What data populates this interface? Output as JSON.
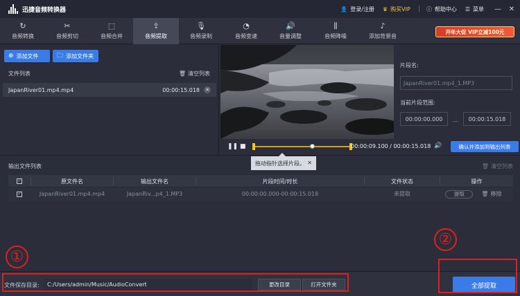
{
  "app": {
    "title": "迅捷音频转换器",
    "login": "登录/注册",
    "buy_vip": "购买VIP",
    "help": "帮助中心",
    "menu": "菜单",
    "minimize": "—",
    "close": "✕"
  },
  "tabs": [
    {
      "label": "音频转换",
      "icon": "↻"
    },
    {
      "label": "音频剪切",
      "icon": "✂"
    },
    {
      "label": "音频合并",
      "icon": "⬚"
    },
    {
      "label": "音频提取",
      "icon": "⇪"
    },
    {
      "label": "音频录制",
      "icon": "🎙"
    },
    {
      "label": "音频变速",
      "icon": "◔"
    },
    {
      "label": "音量调整",
      "icon": "🔊"
    },
    {
      "label": "音频降噪",
      "icon": "⫼"
    },
    {
      "label": "添加背景音",
      "icon": "♪"
    }
  ],
  "promo": "开年大促 VIP立减100元",
  "file_panel": {
    "add_file": "添加文件",
    "add_folder": "添加文件夹",
    "list_title": "文件列表",
    "clear_list": "清空列表",
    "files": [
      {
        "name": "JapanRiver01.mp4.mp4",
        "duration": "00:00:15.018"
      }
    ]
  },
  "player": {
    "current_time": "00:00:09.100",
    "separator": "/",
    "total_time": "00:00:15.018",
    "confirm_button": "确认并添加到输出列表",
    "playhead_fraction": 0.606
  },
  "segment": {
    "name_label": "片段名:",
    "name_placeholder": "JapanRiver01.mp4_1.MP3",
    "range_label": "当前片段范围:",
    "start": "00:00:00.000",
    "dash": "—",
    "end": "00:00:15.018"
  },
  "tooltip": {
    "text": "拖动指针选择片段。",
    "close": "✕"
  },
  "output": {
    "title": "输出文件列表",
    "clear": "清空列表",
    "columns": [
      "原文件名",
      "输出文件名",
      "片段时间/时长",
      "文件状态",
      "操作"
    ],
    "rows": [
      {
        "source": "JapanRiver01.mp4.mp4",
        "output": "JapanRiv...p4_1.MP3",
        "segment": "00:00:00.000-00:00:15.018",
        "status": "未提取",
        "extract": "提取",
        "remove": "移除"
      }
    ]
  },
  "bottom": {
    "save_label": "文件保存目录:",
    "save_path": "C:/Users/admin/Music/AudioConvert",
    "change_dir": "更改目录",
    "open_folder": "打开文件夹",
    "extract_all": "全部提取"
  },
  "annotations": {
    "one": "①",
    "two": "②",
    "color": "#e02020"
  },
  "colors": {
    "accent": "#3a7be8",
    "timeline": "#f5c518",
    "vip": "#f2c14e"
  }
}
